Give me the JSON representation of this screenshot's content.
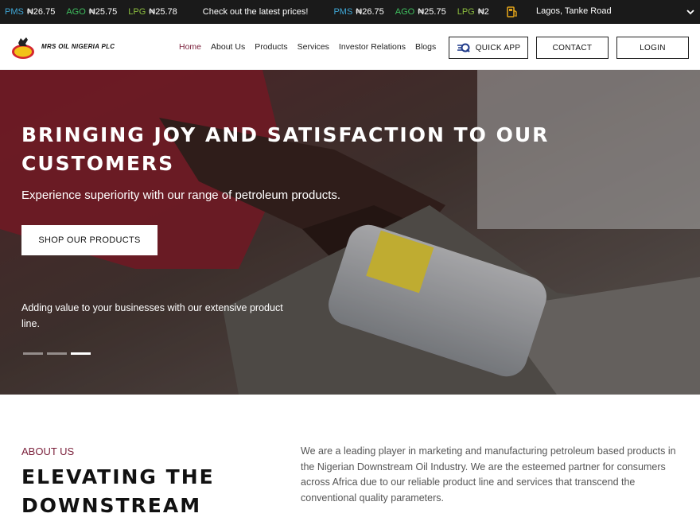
{
  "ticker": {
    "items": [
      {
        "label": "PMS",
        "value": "₦26.75",
        "color": "#3fa7d6"
      },
      {
        "label": "AGO",
        "value": "₦25.75",
        "color": "#3fbf5f"
      },
      {
        "label": "LPG",
        "value": "₦25.78",
        "color": "#8dbf3f"
      }
    ],
    "message": "Check out the latest prices!",
    "items_repeat": [
      {
        "label": "PMS",
        "value": "₦26.75",
        "color": "#3fa7d6"
      },
      {
        "label": "AGO",
        "value": "₦25.75",
        "color": "#3fbf5f"
      },
      {
        "label": "LPG",
        "value": "₦2",
        "color": "#8dbf3f"
      }
    ],
    "location": "Lagos, Tanke Road"
  },
  "header": {
    "brand": "MRS OIL NIGERIA PLC",
    "logo_text": "MRS",
    "nav": [
      "Home",
      "About Us",
      "Products",
      "Services",
      "Investor Relations",
      "Blogs"
    ],
    "active_nav": "Home",
    "quick_app": "QUICK APP",
    "contact": "CONTACT",
    "login": "LOGIN"
  },
  "hero": {
    "title": "BRINGING JOY AND SATISFACTION TO OUR CUSTOMERS",
    "subtitle": "Experience superiority with our range of petroleum products.",
    "cta": "SHOP OUR PRODUCTS",
    "note": "Adding value to your businesses with our extensive product line.",
    "slides": 3,
    "active_slide": 3
  },
  "about": {
    "label": "ABOUT US",
    "title": "ELEVATING THE DOWNSTREAM",
    "text": "We are a leading player in marketing and manufacturing petroleum based products in the Nigerian Downstream Oil Industry. We are the esteemed partner for consumers across Africa due to our reliable product line and services that transcend the conventional quality parameters."
  },
  "colors": {
    "accent": "#7a1f3a",
    "ticker_bg": "#1a1a1a",
    "dot": "#e0a21a"
  },
  "icons": {
    "pump": "fuel-pump-icon",
    "chevron": "chevron-down-icon",
    "quick": "quick-app-icon"
  }
}
